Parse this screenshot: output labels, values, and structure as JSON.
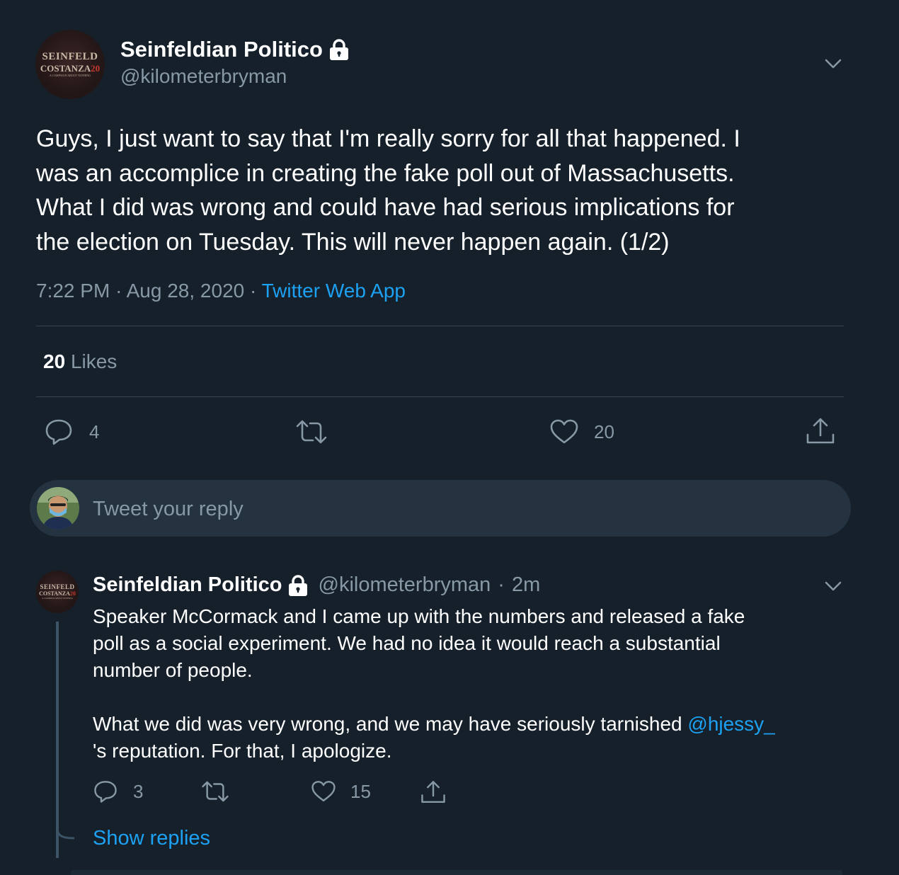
{
  "main_tweet": {
    "author": {
      "display_name": "Seinfeldian Politico",
      "handle": "@kilometerbryman",
      "avatar_text": {
        "line1": "SEINFELD",
        "line2a": "COSTANZA",
        "line2b": "20",
        "line3": "A CAMPAIGN ABOUT NOTHING"
      }
    },
    "text_lines": [
      "Guys, I just want to say that I'm really sorry for all that happened. I",
      "was an accomplice in creating the fake poll out of Massachusetts.",
      "What I did was wrong and could have had serious implications for",
      "the election on Tuesday. This will never happen again. (1/2)"
    ],
    "time": "7:22 PM",
    "date": "Aug 28, 2020",
    "separator": "·",
    "source": "Twitter Web App",
    "likes_count": "20",
    "likes_label": "Likes",
    "actions": {
      "reply_count": "4",
      "like_count": "20"
    }
  },
  "reply_box": {
    "placeholder": "Tweet your reply"
  },
  "reply_tweet": {
    "author": {
      "display_name": "Seinfeldian Politico",
      "handle": "@kilometerbryman",
      "time": "2m"
    },
    "paragraph1": [
      "Speaker McCormack and I came up with the numbers and released a fake",
      "poll as a social experiment. We had no idea it would reach a substantial",
      "number of people."
    ],
    "paragraph2_line1_text": "What we did was very wrong, and we may have seriously tarnished ",
    "mention": "@hjessy_",
    "paragraph2_line2": "'s reputation. For that, I apologize.",
    "actions": {
      "reply_count": "3",
      "like_count": "15"
    },
    "show_replies": "Show replies"
  },
  "icons": [
    "lock-icon",
    "chevron-down-icon",
    "reply-icon",
    "retweet-icon",
    "like-icon",
    "share-icon"
  ],
  "colors": {
    "background": "#15202b",
    "accent": "#1da1f2",
    "muted": "#8899a6",
    "divider": "#38444d",
    "input_bg": "#253341"
  }
}
